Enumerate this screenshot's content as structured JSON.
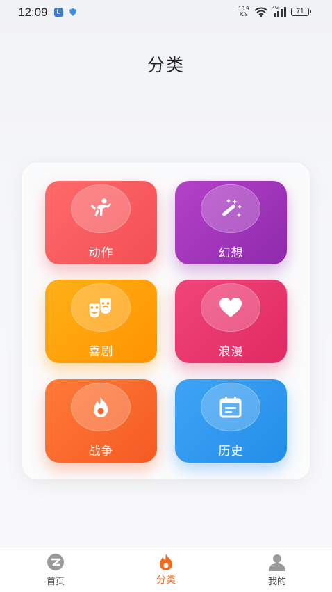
{
  "status_bar": {
    "time": "12:09",
    "app_badge": "U",
    "net_speed_top": "10.9",
    "net_speed_bottom": "K/s",
    "cell_tag": "4G",
    "battery": "71"
  },
  "page": {
    "title": "分类"
  },
  "categories": [
    {
      "label": "动作",
      "icon": "martial-arts-kick-icon",
      "color": "#f24e56"
    },
    {
      "label": "幻想",
      "icon": "magic-wand-icon",
      "color": "#9c30b8"
    },
    {
      "label": "喜剧",
      "icon": "theater-masks-icon",
      "color": "#ff9a0a"
    },
    {
      "label": "浪漫",
      "icon": "heart-icon",
      "color": "#e63568"
    },
    {
      "label": "战争",
      "icon": "flame-icon",
      "color": "#f7642c"
    },
    {
      "label": "历史",
      "icon": "calendar-icon",
      "color": "#2f97ee"
    }
  ],
  "bottom_nav": {
    "items": [
      {
        "label": "首页",
        "icon": "home-logo-icon"
      },
      {
        "label": "分类",
        "icon": "flame-category-icon",
        "active": true
      },
      {
        "label": "我的",
        "icon": "user-icon"
      }
    ],
    "active_color": "#f26a1b"
  }
}
